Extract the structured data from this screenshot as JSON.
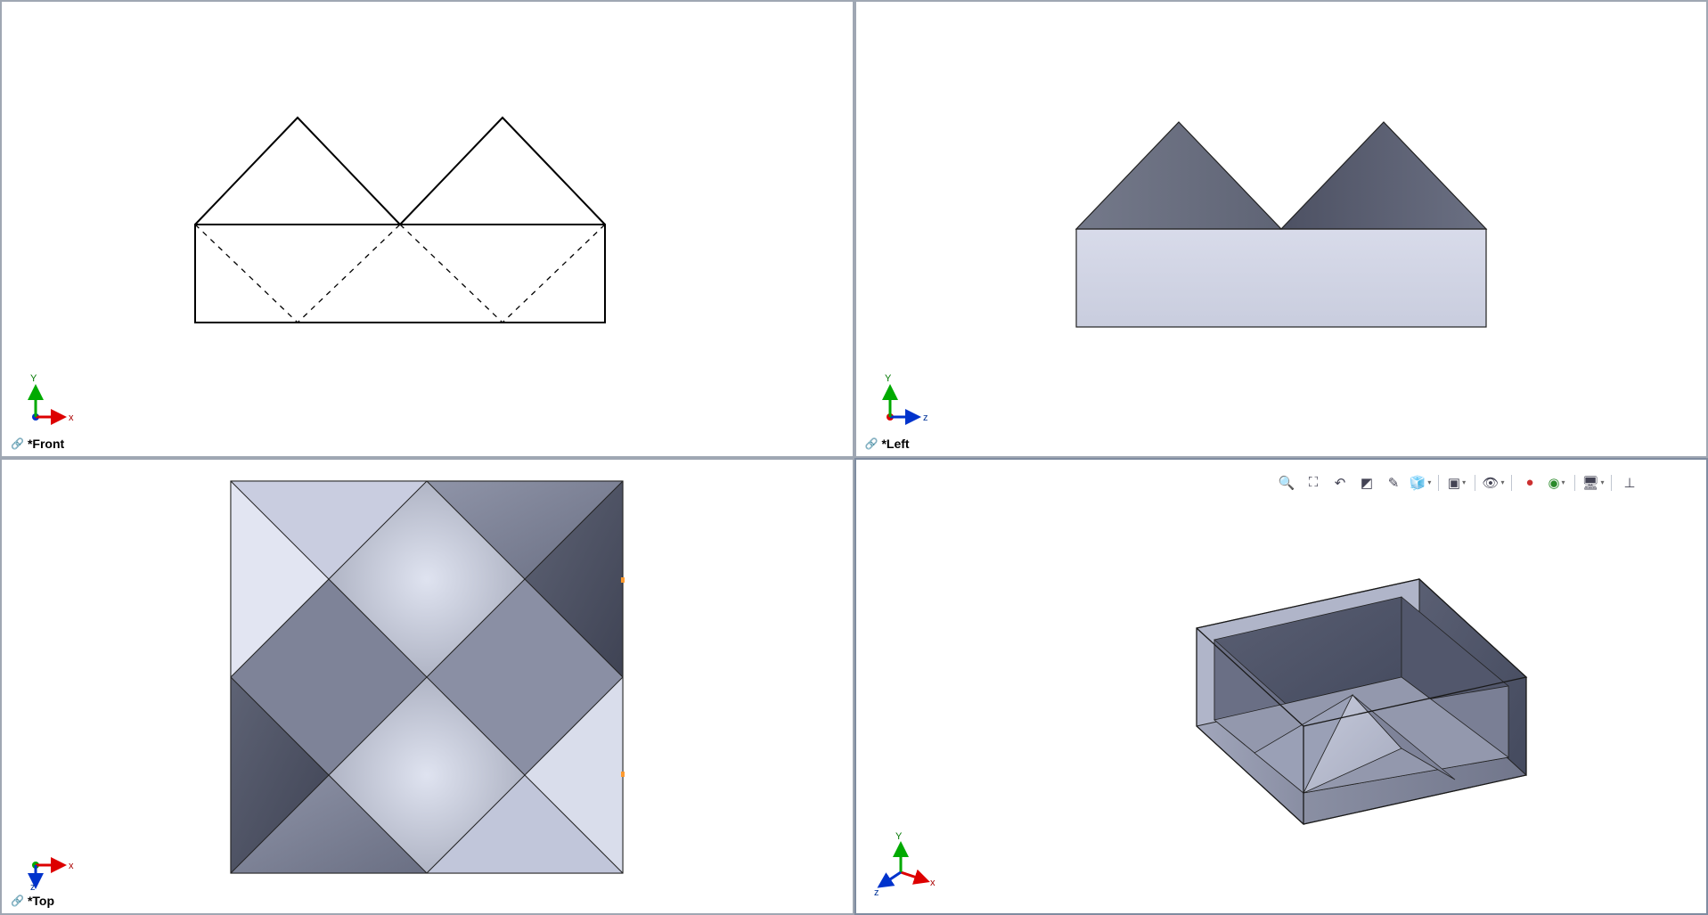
{
  "viewports": {
    "front": {
      "label": "*Front"
    },
    "left": {
      "label": "*Left"
    },
    "top": {
      "label": "*Top"
    },
    "iso": {
      "label": ""
    }
  },
  "toolbar": {
    "zoom_fit": "Zoom to Fit",
    "zoom_area": "Zoom to Area",
    "prev_view": "Previous View",
    "section_view": "Section View",
    "dynamic_anno": "Dynamic Annotation",
    "view_orient": "View Orientation",
    "display_style": "Display Style",
    "hide_show": "Hide/Show",
    "edit_appearance": "Edit Appearance",
    "apply_scene": "Apply Scene",
    "view_settings": "View Settings",
    "normal_to": "Normal To"
  },
  "triad": {
    "x": "x",
    "y": "Y",
    "z": "z"
  }
}
